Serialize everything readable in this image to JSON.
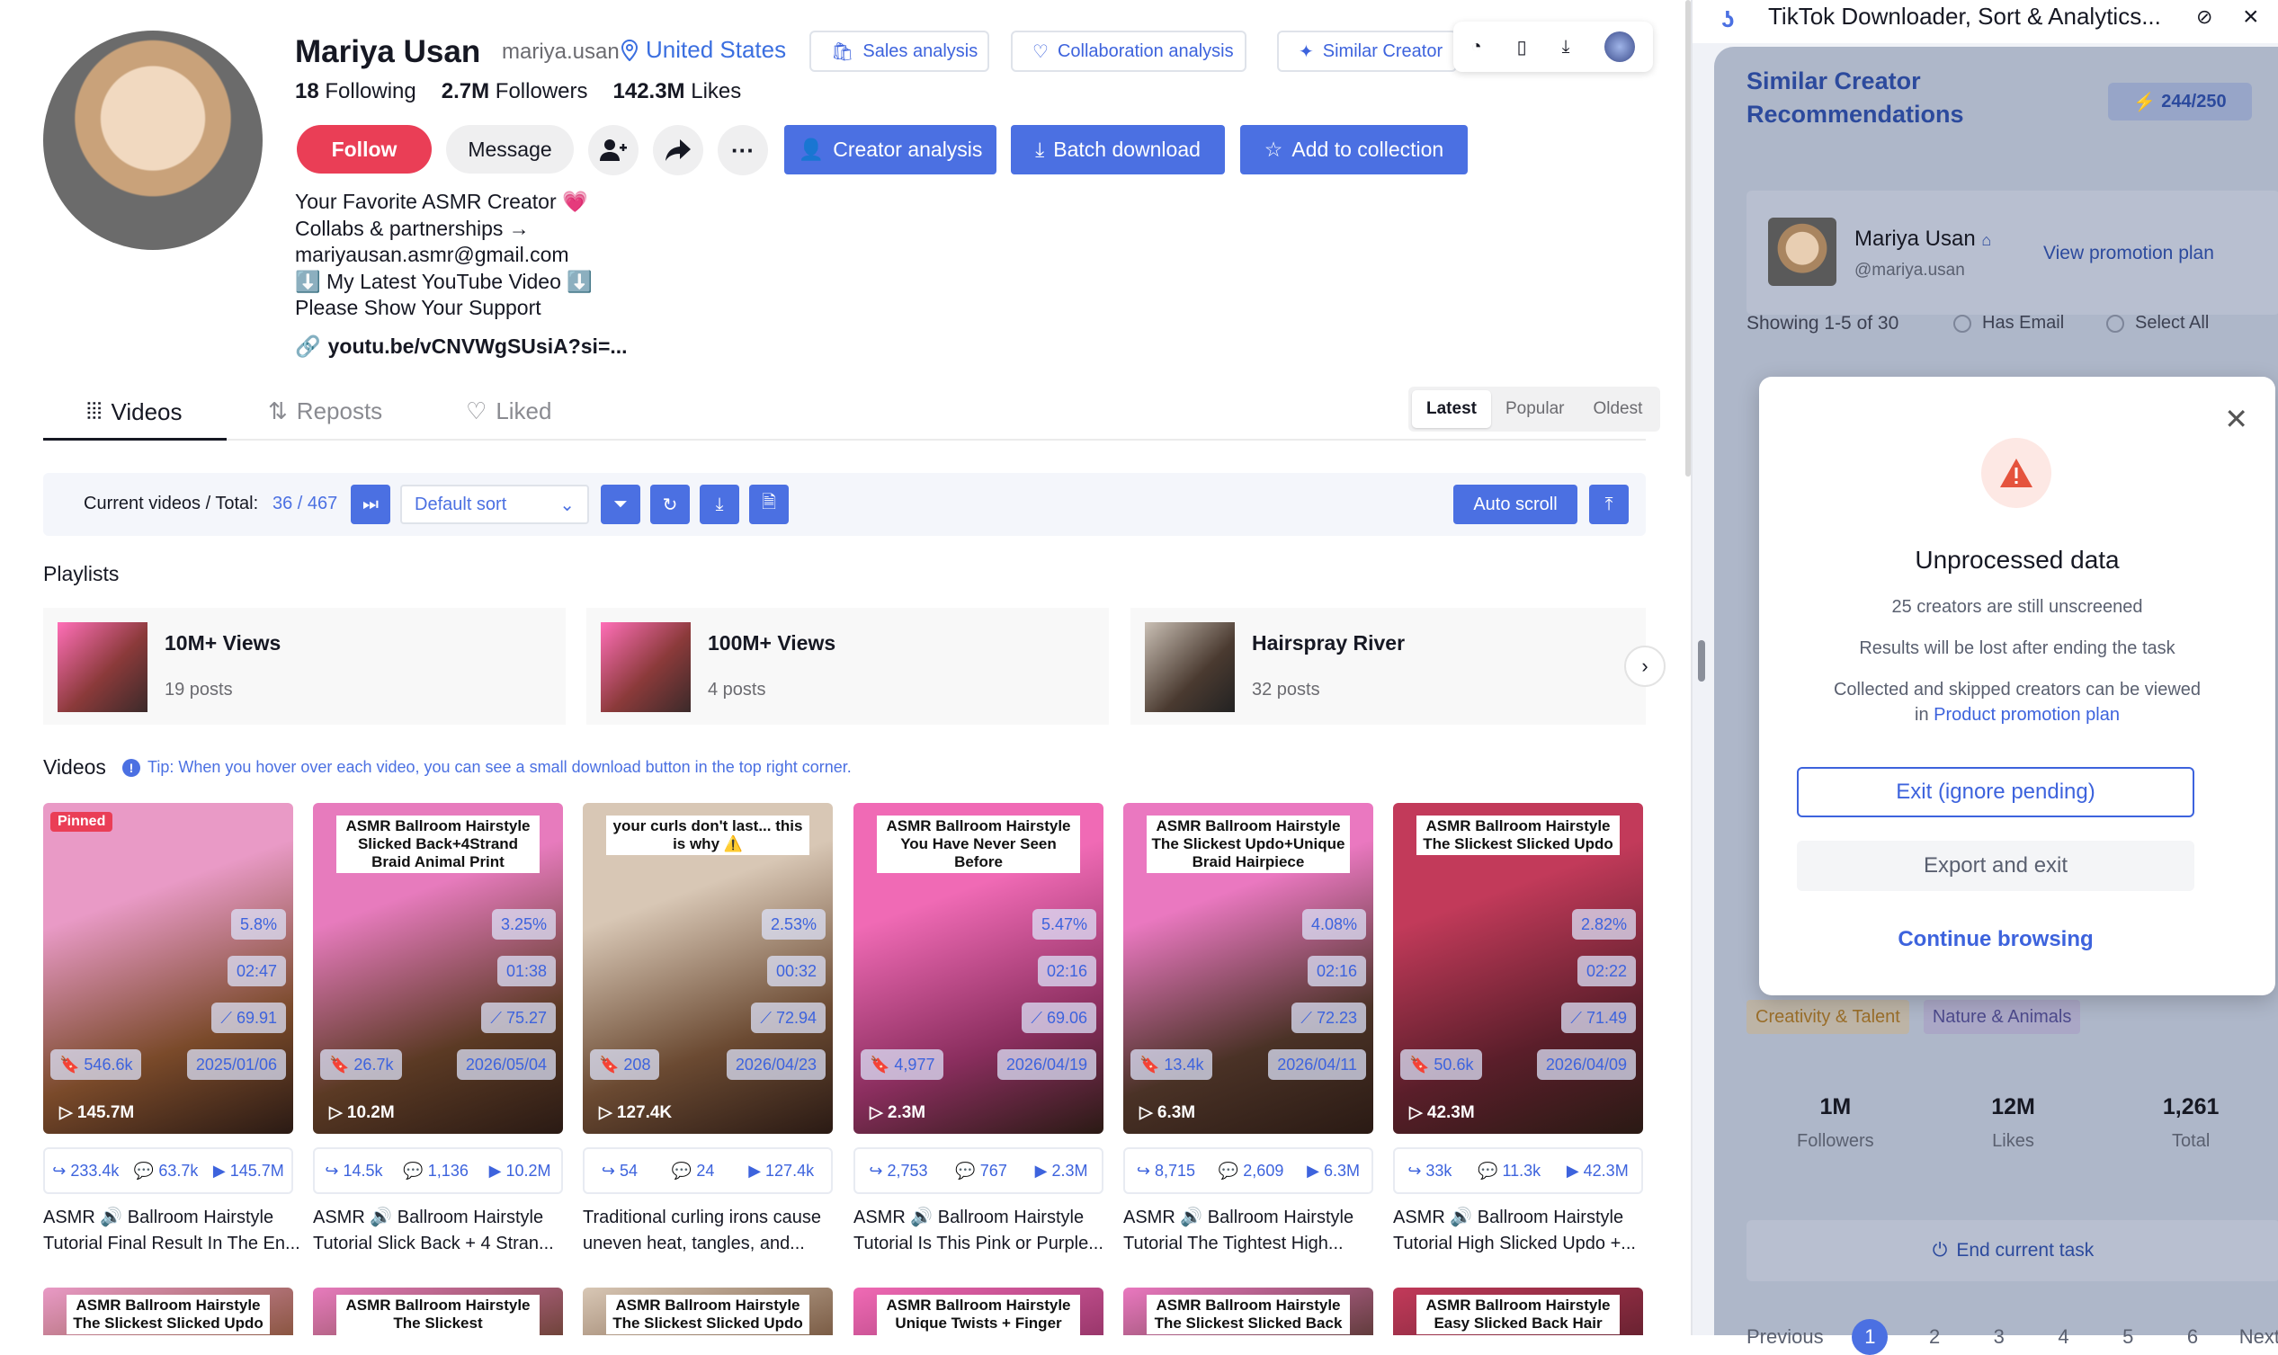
{
  "profile": {
    "name": "Mariya Usan",
    "handle": "mariya.usan",
    "country": "United States",
    "following_count": "18",
    "following_label": "Following",
    "followers_count": "2.7M",
    "followers_label": "Followers",
    "likes_count": "142.3M",
    "likes_label": "Likes",
    "bio_lines": [
      "Your Favorite ASMR Creator 💗",
      "Collabs & partnerships →",
      "mariyausan.asmr@gmail.com",
      "⬇️ My Latest YouTube Video ⬇️",
      "Please Show Your Support"
    ],
    "link": "youtu.be/vCNVWgSUsiA?si=..."
  },
  "top_pills": {
    "sales": "Sales analysis",
    "collab": "Collaboration analysis",
    "similar": "Similar Creator"
  },
  "actions": {
    "follow": "Follow",
    "message": "Message",
    "creator_analysis": "Creator analysis",
    "batch_download": "Batch download",
    "add_collection": "Add to collection"
  },
  "tabs": {
    "videos": "Videos",
    "reposts": "Reposts",
    "liked": "Liked"
  },
  "sort_segments": {
    "latest": "Latest",
    "popular": "Popular",
    "oldest": "Oldest"
  },
  "toolbar": {
    "label": "Current videos / Total:",
    "count": "36 / 467",
    "sort_value": "Default sort",
    "auto_scroll": "Auto scroll"
  },
  "playlists_title": "Playlists",
  "playlists": [
    {
      "title": "10M+ Views",
      "posts": "19 posts"
    },
    {
      "title": "100M+ Views",
      "posts": "4 posts"
    },
    {
      "title": "Hairspray River",
      "posts": "32 posts"
    }
  ],
  "videos_title": "Videos",
  "tip": "Tip: When you hover over each video, you can see a small download button in the top right corner.",
  "videos": [
    {
      "caption": "",
      "pinned": "Pinned",
      "rate": "5.8%",
      "duration": "02:47",
      "score": "69.91",
      "saves": "546.6k",
      "date": "2025/01/06",
      "views": "145.7M",
      "shares": "233.4k",
      "comments": "63.7k",
      "plays": "145.7M",
      "title1": "ASMR 🔊 Ballroom Hairstyle",
      "title2": "Tutorial Final Result In The En...",
      "c1": "#e99ac6",
      "c2": "#7a4a2a"
    },
    {
      "caption": "ASMR Ballroom Hairstyle Slicked Back+4Strand Braid Animal Print",
      "pinned": "",
      "rate": "3.25%",
      "duration": "01:38",
      "score": "75.27",
      "saves": "26.7k",
      "date": "2026/05/04",
      "views": "10.2M",
      "shares": "14.5k",
      "comments": "1,136",
      "plays": "10.2M",
      "title1": "ASMR 🔊 Ballroom Hairstyle",
      "title2": "Tutorial Slick Back + 4 Stran...",
      "c1": "#e77bbd",
      "c2": "#5b3a24"
    },
    {
      "caption": "your curls don't last... this is why ⚠️",
      "pinned": "",
      "rate": "2.53%",
      "duration": "00:32",
      "score": "72.94",
      "saves": "208",
      "date": "2026/04/23",
      "views": "127.4K",
      "shares": "54",
      "comments": "24",
      "plays": "127.4k",
      "title1": "Traditional curling irons cause",
      "title2": "uneven heat, tangles, and...",
      "c1": "#d8c7b5",
      "c2": "#6b4a32"
    },
    {
      "caption": "ASMR Ballroom Hairstyle You Have Never Seen Before",
      "pinned": "",
      "rate": "5.47%",
      "duration": "02:16",
      "score": "69.06",
      "saves": "4,977",
      "date": "2026/04/19",
      "views": "2.3M",
      "shares": "2,753",
      "comments": "767",
      "plays": "2.3M",
      "title1": "ASMR 🔊 Ballroom Hairstyle",
      "title2": "Tutorial Is This Pink or Purple...",
      "c1": "#f06ab5",
      "c2": "#8a2e5e"
    },
    {
      "caption": "ASMR Ballroom Hairstyle The Slickest Updo+Unique Braid Hairpiece",
      "pinned": "",
      "rate": "4.08%",
      "duration": "02:16",
      "score": "72.23",
      "saves": "13.4k",
      "date": "2026/04/11",
      "views": "6.3M",
      "shares": "8,715",
      "comments": "2,609",
      "plays": "6.3M",
      "title1": "ASMR 🔊 Ballroom Hairstyle",
      "title2": "Tutorial The Tightest High...",
      "c1": "#ea78c0",
      "c2": "#4a3226"
    },
    {
      "caption": "ASMR Ballroom Hairstyle The Slickest Slicked Updo",
      "pinned": "",
      "rate": "2.82%",
      "duration": "02:22",
      "score": "71.49",
      "saves": "50.6k",
      "date": "2026/04/09",
      "views": "42.3M",
      "shares": "33k",
      "comments": "11.3k",
      "plays": "42.3M",
      "title1": "ASMR 🔊 Ballroom Hairstyle",
      "title2": "Tutorial High Slicked Updo +...",
      "c1": "#c23a5a",
      "c2": "#5a1e2a"
    }
  ],
  "next_row_captions": [
    "ASMR Ballroom Hairstyle The Slickest Slicked Updo",
    "ASMR Ballroom Hairstyle The Slickest Slick+Ponytail Extensions",
    "ASMR Ballroom Hairstyle The Slickest Slicked Updo",
    "ASMR Ballroom Hairstyle Unique Twists + Finger Wave",
    "ASMR Ballroom Hairstyle The Slickest Slicked Back",
    "ASMR Ballroom Hairstyle Easy Slicked Back Hair"
  ],
  "side": {
    "window_title": "TikTok Downloader, Sort & Analytics...",
    "panel_title_1": "Similar Creator",
    "panel_title_2": "Recommendations",
    "credits": "244/250",
    "creator_name": "Mariya Usan",
    "creator_handle": "@mariya.usan",
    "view_plan": "View promotion plan",
    "showing": "Showing 1-5 of 30",
    "has_email": "Has Email",
    "select_all": "Select All",
    "cat1": "Creativity & Talent",
    "cat2": "Nature & Animals",
    "stat1_n": "1M",
    "stat1_l": "Followers",
    "stat2_n": "12M",
    "stat2_l": "Likes",
    "stat3_n": "1,261",
    "stat3_l": "Total",
    "end_task": "End current task",
    "prev": "Previous",
    "pages": [
      "1",
      "2",
      "3",
      "4",
      "5",
      "6"
    ],
    "next": "Next"
  },
  "modal": {
    "title": "Unprocessed data",
    "line1": "25 creators are still unscreened",
    "line2": "Results will be lost after ending the task",
    "line3": "Collected and skipped creators can be viewed",
    "line4_prefix": "in",
    "line4_link": "Product promotion plan",
    "exit": "Exit (ignore pending)",
    "export": "Export and exit",
    "continue": "Continue browsing"
  },
  "colors": {
    "accent": "#4b70e2",
    "follow": "#ea3e56",
    "link": "#3d63dd"
  }
}
